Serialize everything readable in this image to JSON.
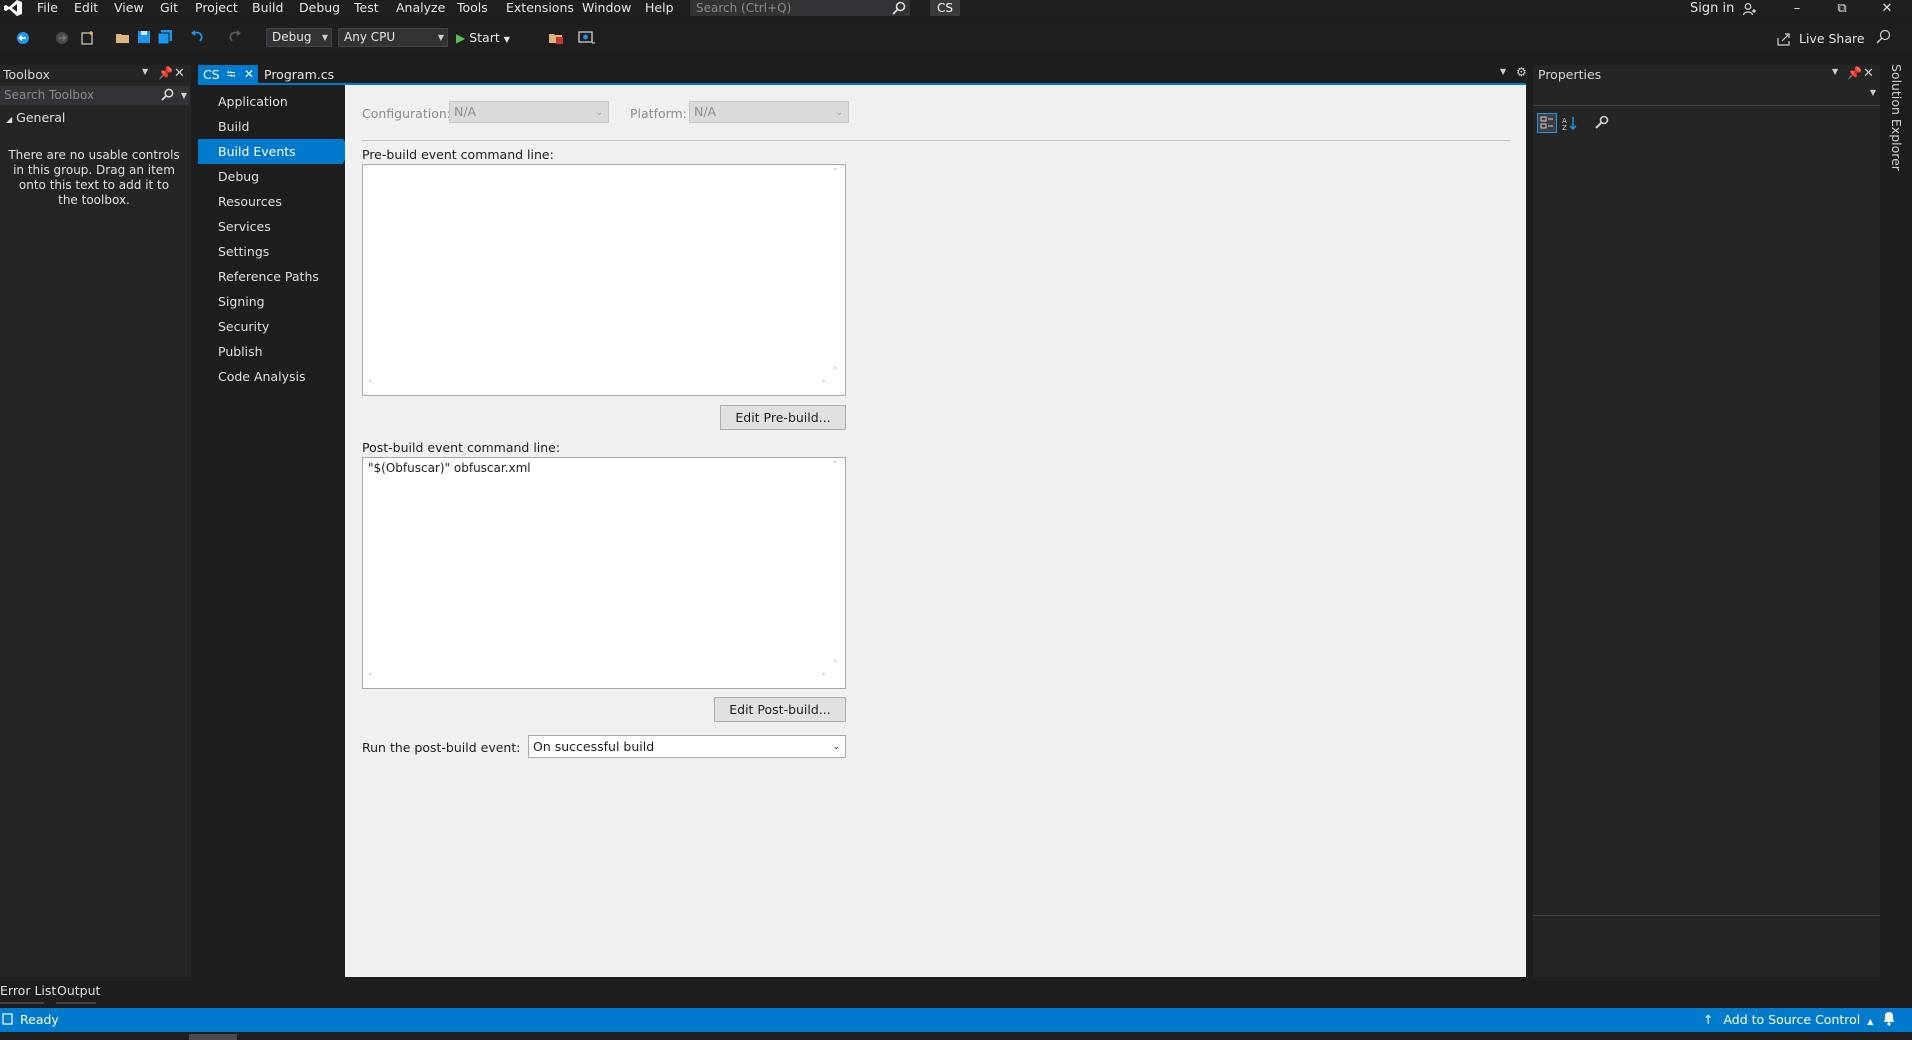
{
  "menu": {
    "items": [
      "File",
      "Edit",
      "View",
      "Git",
      "Project",
      "Build",
      "Debug",
      "Test",
      "Analyze",
      "Tools",
      "Extensions",
      "Window",
      "Help"
    ],
    "search_placeholder": "Search (Ctrl+Q)",
    "project_badge": "CS",
    "sign_in": "Sign in"
  },
  "toolbar": {
    "configuration": "Debug",
    "platform": "Any CPU",
    "start_label": "Start",
    "live_share": "Live Share"
  },
  "toolbox": {
    "title": "Toolbox",
    "search_placeholder": "Search Toolbox",
    "group": "General",
    "empty_message": "There are no usable controls in this group. Drag an item onto this text to add it to the toolbox."
  },
  "tabs": [
    {
      "label": "CS",
      "active": true
    },
    {
      "label": "Program.cs",
      "active": false
    }
  ],
  "nav": {
    "items": [
      "Application",
      "Build",
      "Build Events",
      "Debug",
      "Resources",
      "Services",
      "Settings",
      "Reference Paths",
      "Signing",
      "Security",
      "Publish",
      "Code Analysis"
    ],
    "active": "Build Events"
  },
  "build_events": {
    "configuration_label": "Configuration:",
    "configuration_value": "N/A",
    "platform_label": "Platform:",
    "platform_value": "N/A",
    "prebuild_label": "Pre-build event command line:",
    "prebuild_value": "",
    "edit_prebuild_button": "Edit Pre-build...",
    "postbuild_label": "Post-build event command line:",
    "postbuild_value": "\"$(Obfuscar)\" obfuscar.xml",
    "edit_postbuild_button": "Edit Post-build...",
    "run_label": "Run the post-build event:",
    "run_value": "On successful build"
  },
  "properties": {
    "title": "Properties"
  },
  "side_tabs": {
    "solution_explorer": "Solution Explorer"
  },
  "bottom_tabs": [
    "Error List",
    "Output"
  ],
  "status": {
    "ready": "Ready",
    "source_control": "Add to Source Control"
  },
  "colors": {
    "accent": "#007acc",
    "background": "#1e1e1e",
    "panel": "#252526",
    "page": "#f0f0f0"
  }
}
